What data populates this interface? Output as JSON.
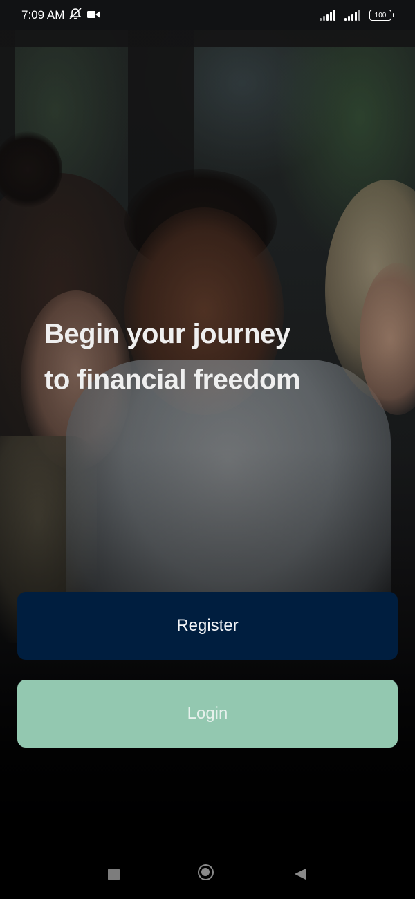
{
  "status_bar": {
    "time": "7:09 AM",
    "left_icons": [
      "muted-bell-icon",
      "video-camera-icon"
    ],
    "right_icons": [
      "signal-icon",
      "signal-icon",
      "battery-icon"
    ],
    "battery_level": "100"
  },
  "hero": {
    "headline_line1": "Begin your journey",
    "headline_line2": "to financial freedom"
  },
  "actions": {
    "register_label": "Register",
    "login_label": "Login"
  },
  "colors": {
    "register_bg": "#001e3f",
    "login_bg": "#93c8b0",
    "headline_text": "#efefef"
  },
  "nav_bar": {
    "icons": [
      "recents-square-icon",
      "home-circle-icon",
      "back-triangle-icon"
    ]
  }
}
